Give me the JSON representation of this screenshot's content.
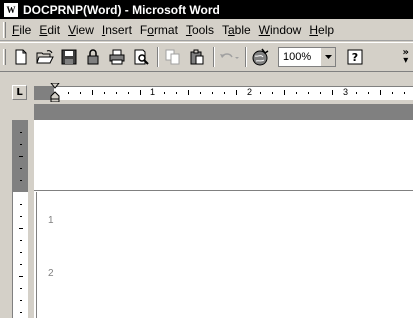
{
  "window": {
    "title": "DOCPRNP(Word) - Microsoft Word"
  },
  "menubar": {
    "items": [
      {
        "label": "File",
        "accel": "F",
        "rest": "ile"
      },
      {
        "label": "Edit",
        "accel": "E",
        "rest": "dit"
      },
      {
        "label": "View",
        "accel": "V",
        "rest": "iew"
      },
      {
        "label": "Insert",
        "accel": "I",
        "rest": "nsert"
      },
      {
        "label": "Format",
        "pre": "F",
        "accel": "o",
        "rest": "rmat"
      },
      {
        "label": "Tools",
        "accel": "T",
        "rest": "ools"
      },
      {
        "label": "Table",
        "pre": "T",
        "accel": "a",
        "rest": "ble"
      },
      {
        "label": "Window",
        "accel": "W",
        "rest": "indow"
      },
      {
        "label": "Help",
        "accel": "H",
        "rest": "elp"
      }
    ]
  },
  "toolbar": {
    "buttons": [
      "new-document-icon",
      "open-folder-icon",
      "save-icon",
      "permission-icon",
      "print-icon",
      "print-preview-icon",
      "copy-icon",
      "paste-icon",
      "undo-icon",
      "web-toolbar-icon"
    ],
    "zoom": "100%",
    "help_icon": "question-mark-icon"
  },
  "ruler": {
    "numbers": [
      "1",
      "2",
      "3"
    ],
    "tab_selector": "L"
  },
  "document": {
    "line_numbers": [
      "1",
      "2"
    ]
  }
}
